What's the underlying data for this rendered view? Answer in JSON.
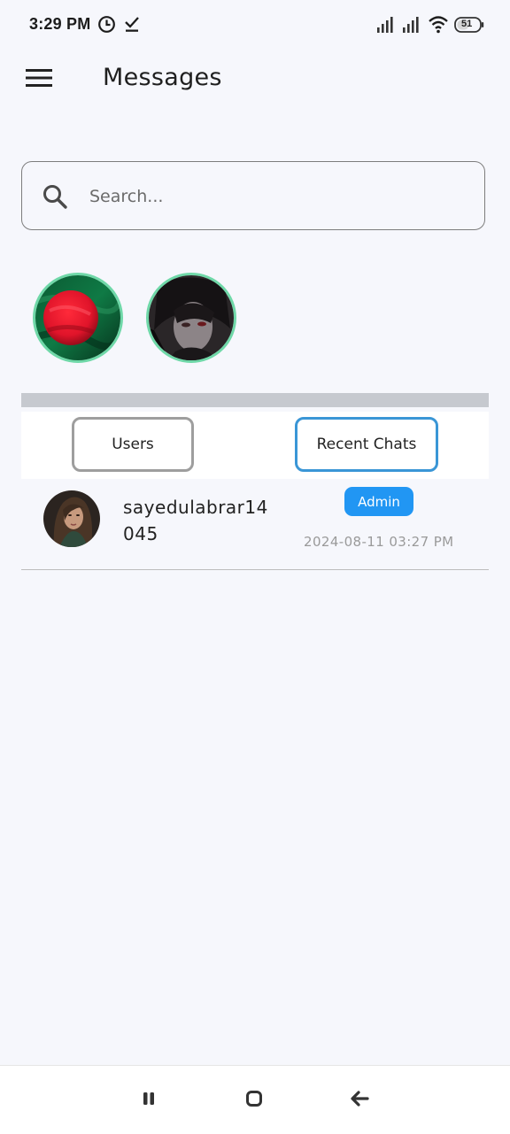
{
  "status_bar": {
    "time": "3:29 PM",
    "battery": "51",
    "icons": [
      "alarm-clock-icon",
      "download-done-icon",
      "signal-icon",
      "signal-icon",
      "wifi-icon",
      "battery-icon"
    ]
  },
  "app_bar": {
    "title": "Messages",
    "menu_icon": "hamburger-menu-icon"
  },
  "search": {
    "placeholder": "Search..."
  },
  "stories": [
    {
      "name": "story-avatar-flag"
    },
    {
      "name": "story-avatar-anime"
    }
  ],
  "tabs": {
    "users_label": "Users",
    "recent_label": "Recent Chats",
    "active": "recent"
  },
  "chats": [
    {
      "username": "sayedulabrar14045",
      "badge": "Admin",
      "timestamp": "2024-08-11 03:27 PM"
    }
  ],
  "colors": {
    "background": "#f6f7fc",
    "accent": "#2196f3",
    "story_ring": "#6fd8a8",
    "active_tab_border": "#3a96d6"
  }
}
